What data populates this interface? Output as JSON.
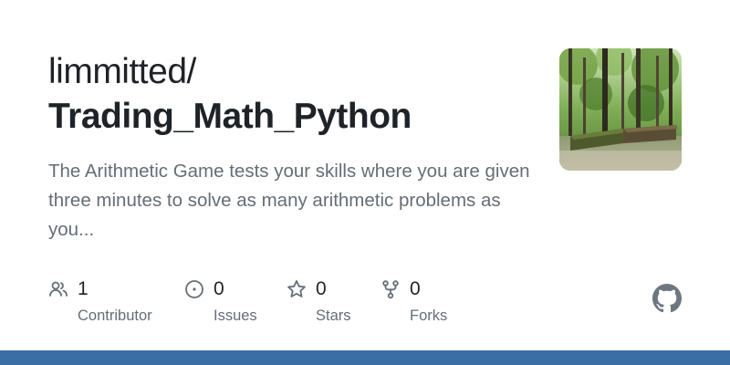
{
  "repo": {
    "owner": "limmitted/",
    "name": "Trading_Math_Python",
    "description": "The Arithmetic Game tests your skills where you are given three minutes to solve as many arithmetic problems as you..."
  },
  "stats": [
    {
      "count": "1",
      "label": "Contributor",
      "icon": "people-icon"
    },
    {
      "count": "0",
      "label": "Issues",
      "icon": "issue-icon"
    },
    {
      "count": "0",
      "label": "Stars",
      "icon": "star-icon"
    },
    {
      "count": "0",
      "label": "Forks",
      "icon": "fork-icon"
    }
  ],
  "colors": {
    "title": "#1f2328",
    "muted": "#656d76",
    "bottom_bar": "#3b6ea5",
    "logo": "#6e7781"
  },
  "icons": {
    "avatar": "forest-photo",
    "brand": "github-logo"
  }
}
